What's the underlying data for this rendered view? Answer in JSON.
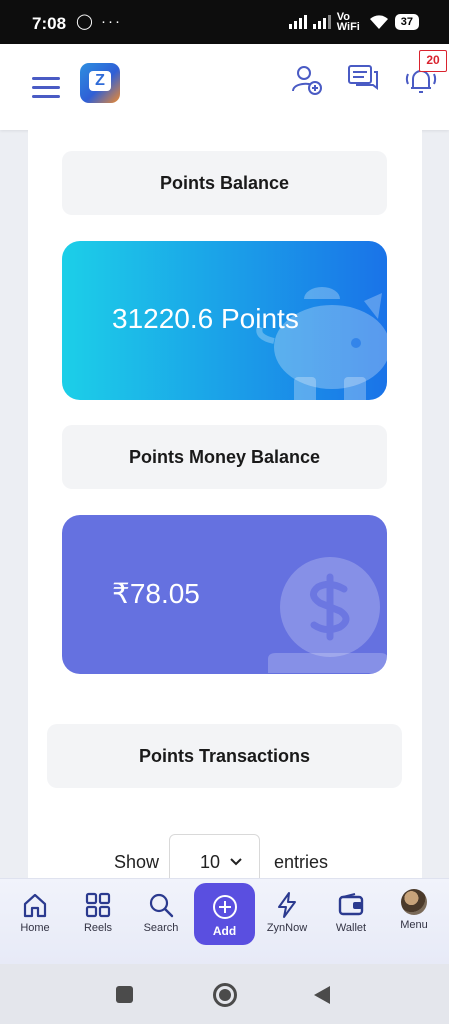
{
  "status_bar": {
    "time": "7:08",
    "left_icons": "◯ ···",
    "network_label": "Vo WiFi",
    "battery": "37"
  },
  "header": {
    "notification_count": "20"
  },
  "points_section": {
    "points_balance_label": "Points Balance",
    "points_value": "31220.6 Points",
    "money_balance_label": "Points Money Balance",
    "money_value": "₹78.05",
    "transactions_label": "Points Transactions"
  },
  "table_controls": {
    "show_label": "Show",
    "entries_value": "10",
    "entries_label": "entries"
  },
  "bottom_nav": {
    "home": "Home",
    "reels": "Reels",
    "search": "Search",
    "add": "Add",
    "zynnow": "ZynNow",
    "wallet": "Wallet",
    "menu": "Menu"
  },
  "colors": {
    "accent": "#4a5bc4",
    "points_card_start": "#1ccfe8",
    "points_card_end": "#1a73e8",
    "money_card": "#6571e0",
    "add_button": "#5a4fe0",
    "badge": "#d9232e"
  }
}
